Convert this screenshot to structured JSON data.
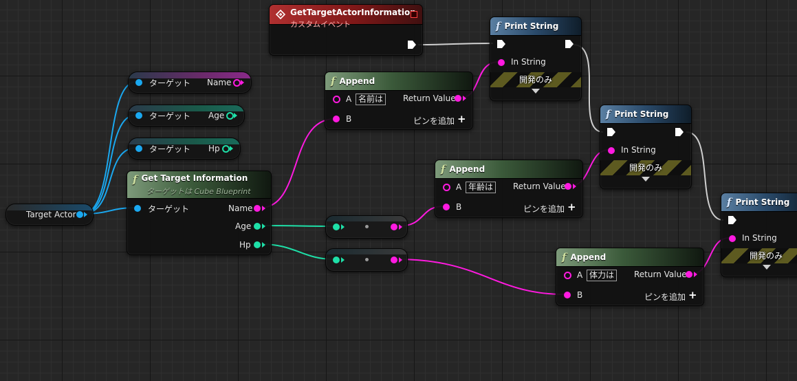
{
  "event_node": {
    "title": "GetTargetActorInformation",
    "subtitle": "カスタムイベント"
  },
  "vars": [
    {
      "target": "ターゲット",
      "name": "Name"
    },
    {
      "target": "ターゲット",
      "name": "Age"
    },
    {
      "target": "ターゲット",
      "name": "Hp"
    }
  ],
  "target_actor": {
    "label": "Target Actor"
  },
  "get_info": {
    "title": "Get Target Information",
    "subtitle": "ターゲットは Cube Blueprint",
    "target_pin": "ターゲット",
    "out_name": "Name",
    "out_age": "Age",
    "out_hp": "Hp"
  },
  "append_nodes": [
    {
      "title": "Append",
      "pin_a": "A",
      "literal_a": "名前は",
      "pin_b": "B",
      "return_value": "Return Value",
      "add_pin": "ピンを追加"
    },
    {
      "title": "Append",
      "pin_a": "A",
      "literal_a": "年齢は",
      "pin_b": "B",
      "return_value": "Return Value",
      "add_pin": "ピンを追加"
    },
    {
      "title": "Append",
      "pin_a": "A",
      "literal_a": "体力は",
      "pin_b": "B",
      "return_value": "Return Value",
      "add_pin": "ピンを追加"
    }
  ],
  "print_nodes": [
    {
      "title": "Print String",
      "in_string": "In String",
      "dev_only": "開発のみ"
    },
    {
      "title": "Print String",
      "in_string": "In String",
      "dev_only": "開発のみ"
    },
    {
      "title": "Print String",
      "in_string": "In String",
      "dev_only": "開発のみ"
    }
  ],
  "colors": {
    "string_pin": "#ff1ae0",
    "object_pin": "#1aa8f0",
    "int_pin": "#1ee0a8",
    "exec_wire": "#e0e0e0"
  }
}
